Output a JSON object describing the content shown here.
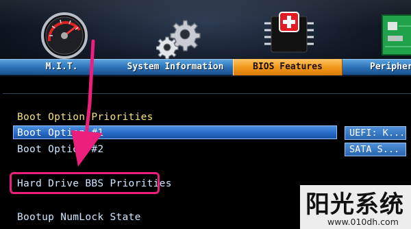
{
  "tabs": [
    {
      "label": "M.I.T.",
      "active": false,
      "icon": "speedometer-icon"
    },
    {
      "label": "System Information",
      "active": false,
      "icon": "gears-icon"
    },
    {
      "label": "BIOS Features",
      "active": true,
      "icon": "chip-icon"
    },
    {
      "label": "Peripher",
      "active": false,
      "icon": "circuit-board-icon"
    }
  ],
  "content": {
    "section_header": "Boot Option Priorities",
    "options": [
      {
        "label": "Boot Option #1",
        "value": "UEFI: K...",
        "selected": true
      },
      {
        "label": "Boot Option #2",
        "value": "SATA  S...",
        "selected": false
      }
    ],
    "highlighted_item": "Hard Drive BBS Priorities",
    "numlock_label": "Bootup NumLock State"
  },
  "annotation": {
    "arrow_color": "#ec1f7c",
    "highlight_color": "#ec1f7c"
  },
  "watermark": {
    "title": "阳光系统",
    "url": "www.010dh.com"
  },
  "colors": {
    "tab_blue": "#2a6fb5",
    "tab_active_orange": "#f39a1b",
    "header_yellow": "#f6e27a",
    "option_text": "#cfe7ff",
    "selection_blue": "#2467c4"
  }
}
